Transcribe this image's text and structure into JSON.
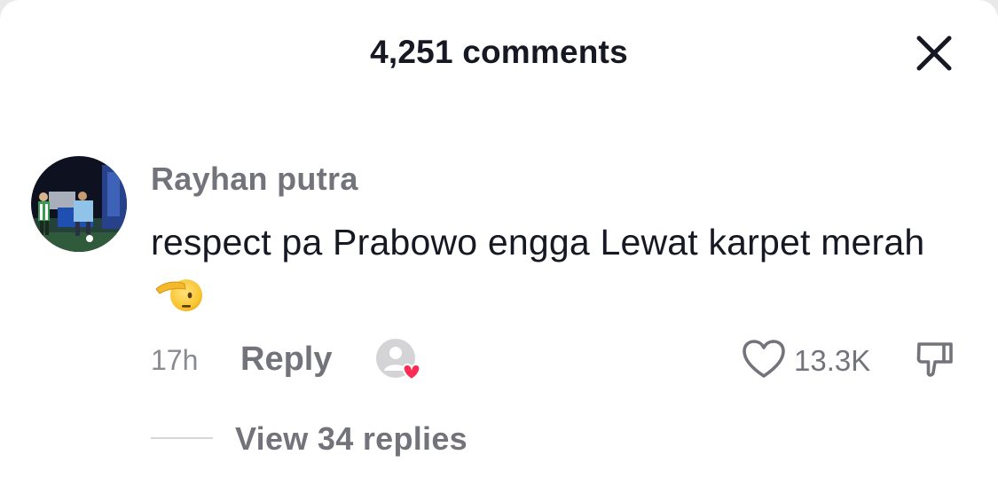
{
  "header": {
    "title": "4,251 comments",
    "close_icon": "close-icon"
  },
  "comment": {
    "username": "Rayhan putra",
    "text": "respect pa Prabowo engga Lewat karpet merah",
    "emoji": "saluting-face",
    "timestamp": "17h",
    "reply_label": "Reply",
    "creator_liked_icon": "creator-liked-icon",
    "like_icon": "heart-outline-icon",
    "like_count": "13.3K",
    "dislike_icon": "thumbs-down-icon",
    "view_replies_label": "View 34 replies"
  },
  "colors": {
    "primary_text": "#161823",
    "secondary_text": "#73747b",
    "like_heart": "#fe2c55"
  }
}
